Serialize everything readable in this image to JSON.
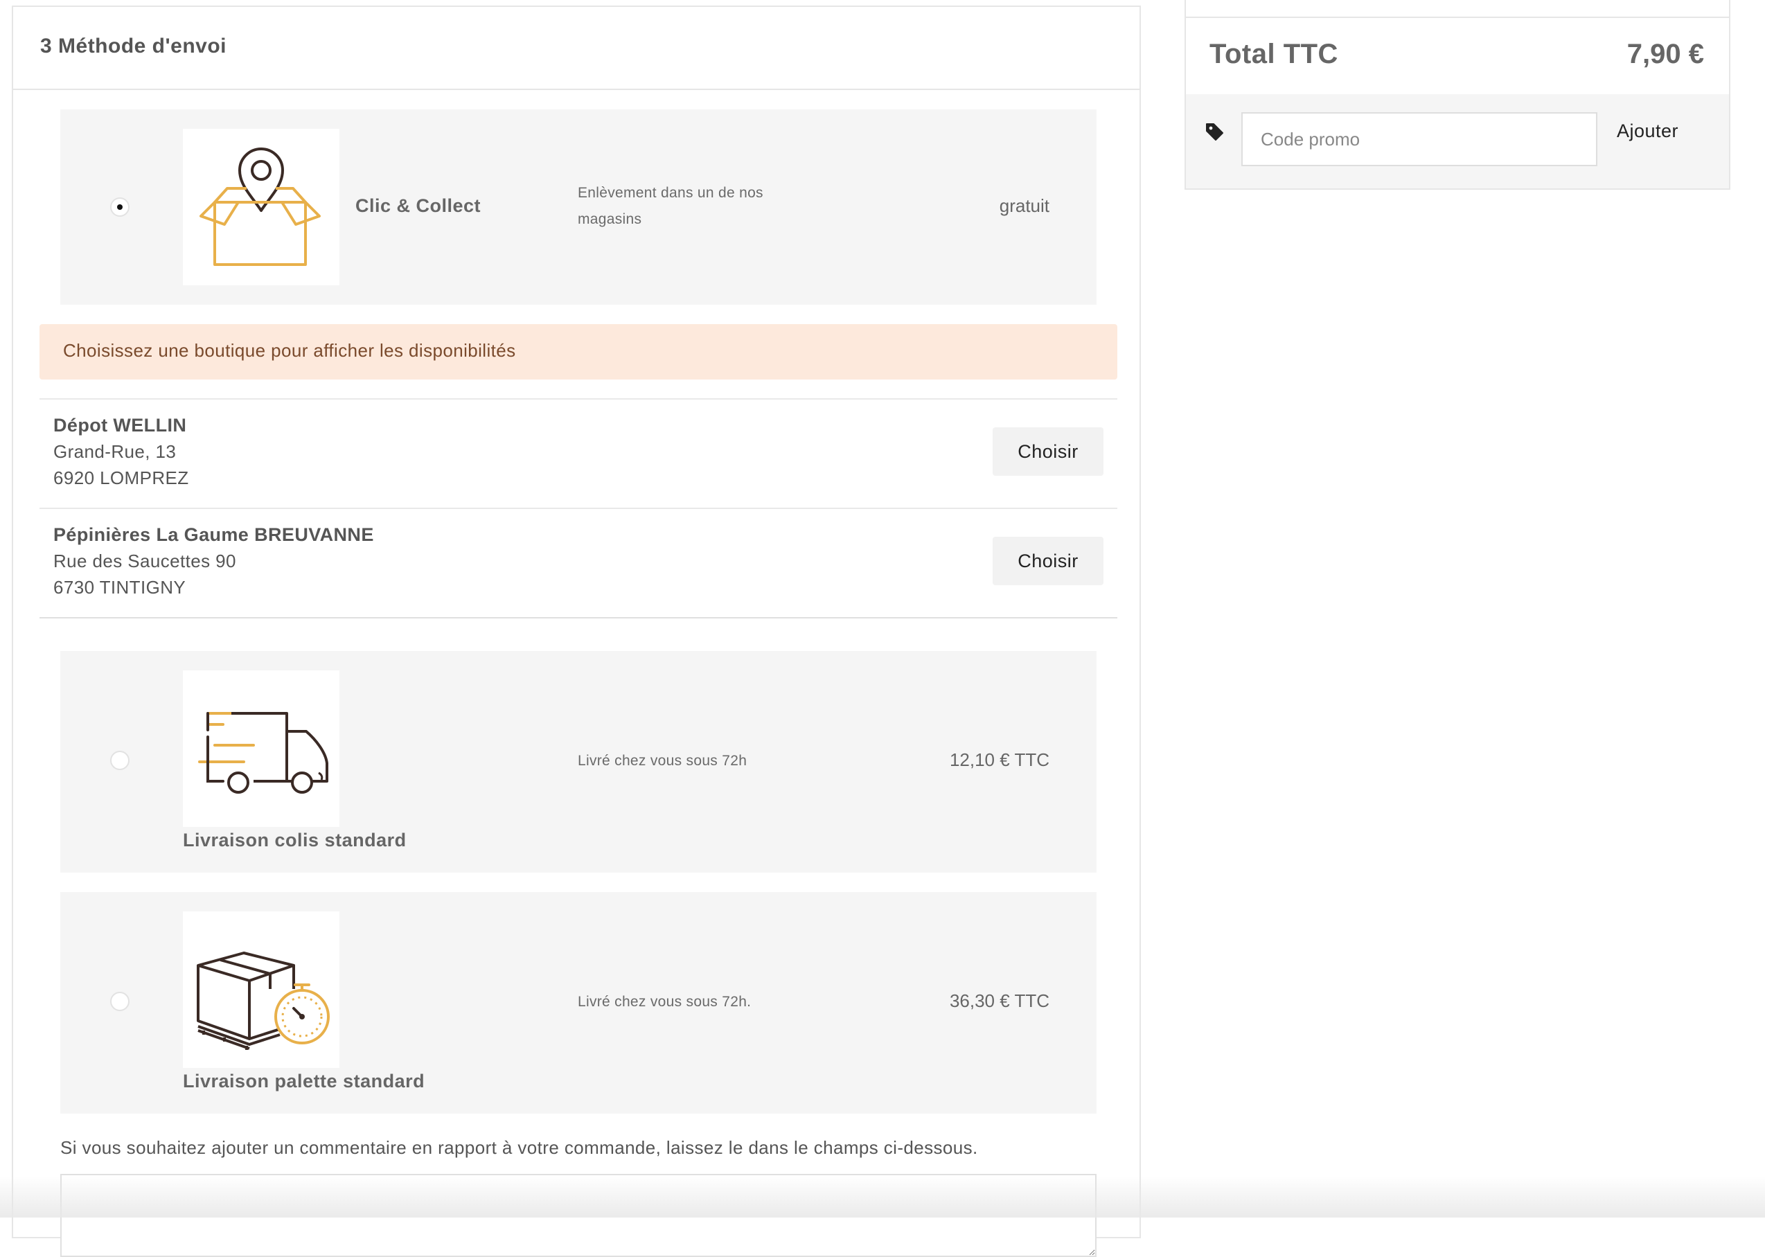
{
  "shipping": {
    "title": "3 Méthode d'envoi",
    "methods": [
      {
        "name": "Clic & Collect",
        "description": "Enlèvement dans un de nos magasins",
        "price": "gratuit",
        "selected": true,
        "icon": "box-location-pin-icon"
      },
      {
        "name": "Livraison colis standard",
        "description": "Livré chez vous sous 72h",
        "price": "12,10 € TTC",
        "selected": false,
        "icon": "delivery-truck-icon"
      },
      {
        "name": "Livraison palette standard",
        "description": "Livré chez vous sous 72h.",
        "price": "36,30 € TTC",
        "selected": false,
        "icon": "pallet-box-timer-icon"
      }
    ],
    "alert": "Choisissez une boutique pour afficher les disponibilités",
    "stores": [
      {
        "name": "Dépot WELLIN",
        "street": "Grand-Rue, 13",
        "city": "6920 LOMPREZ",
        "button": "Choisir"
      },
      {
        "name": "Pépinières La Gaume BREUVANNE",
        "street": "Rue des Saucettes 90",
        "city": "6730 TINTIGNY",
        "button": "Choisir"
      }
    ],
    "comment_label": "Si vous souhaitez ajouter un commentaire en rapport à votre commande, laissez le dans le champs ci-dessous."
  },
  "summary": {
    "total_label": "Total TTC",
    "total_value": "7,90 €",
    "promo_placeholder": "Code promo",
    "promo_button": "Ajouter"
  },
  "colors": {
    "accent_orange": "#e8b04a",
    "icon_dark": "#3a2a25",
    "alert_bg": "#fde9dc",
    "alert_text": "#7a4a2c",
    "card_bg": "#f5f5f5"
  }
}
